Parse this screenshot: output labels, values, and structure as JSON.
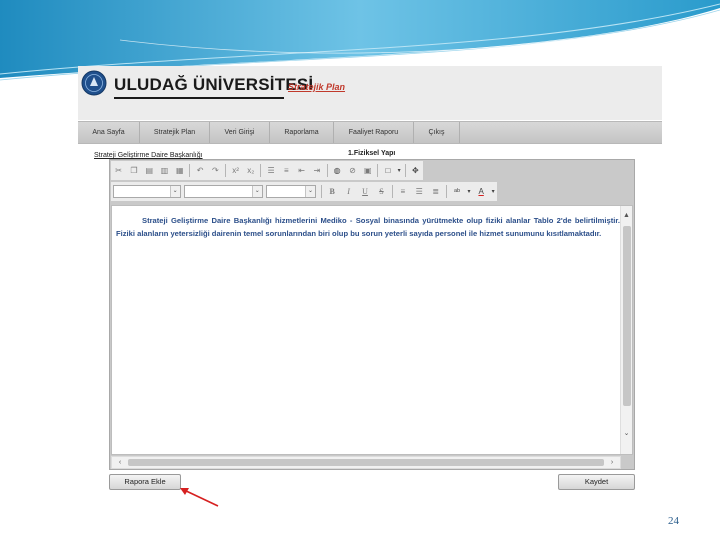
{
  "header": {
    "university_name": "ULUDAĞ ÜNİVERSİTESİ",
    "module_label": "Stratejik Plan",
    "logo_icon": "university-seal-icon"
  },
  "nav": {
    "items": [
      {
        "label": "Ana Sayfa"
      },
      {
        "label": "Stratejik Plan"
      },
      {
        "label": "Veri Girişi"
      },
      {
        "label": "Raporlama"
      },
      {
        "label": "Faaliyet Raporu"
      },
      {
        "label": "Çıkış"
      }
    ]
  },
  "breadcrumb": "Strateji Geliştirme Daire Başkanlığı",
  "section_title": "1.Fiziksel Yapı",
  "editor": {
    "toolbar_icons": [
      "cut-icon",
      "copy-icon",
      "paste-icon",
      "paste-text-icon",
      "paste-word-icon",
      "undo-icon",
      "redo-icon",
      "superscript-icon",
      "subscript-icon",
      "numbered-list-icon",
      "bulleted-list-icon",
      "outdent-icon",
      "indent-icon",
      "link-icon",
      "unlink-icon",
      "image-icon",
      "table-icon",
      "anchor-icon",
      "bold-icon",
      "italic-icon",
      "underline-icon",
      "strikethrough-icon",
      "align-left-icon",
      "align-center-icon",
      "align-right-icon",
      "highlight-color-icon",
      "font-color-icon"
    ],
    "format_select": "",
    "font_select": "",
    "size_select": "",
    "content": "Strateji Geliştirme Daire Başkanlığı hizmetlerini Mediko - Sosyal binasında yürütmekte olup fiziki alanlar Tablo 2'de belirtilmiştir. Fiziki alanların yetersizliği dairenin temel sorunlarından biri olup bu sorun yeterli sayıda personel ile hizmet sunumunu kısıtlamaktadır."
  },
  "buttons": {
    "add_to_report": "Rapora Ekle",
    "save": "Kaydet"
  },
  "annotation_color": "#d62020",
  "page_number": "24",
  "colors": {
    "content_text": "#2c4f8a",
    "plan_label": "#c0392b",
    "page_number": "#2a5d8c"
  }
}
